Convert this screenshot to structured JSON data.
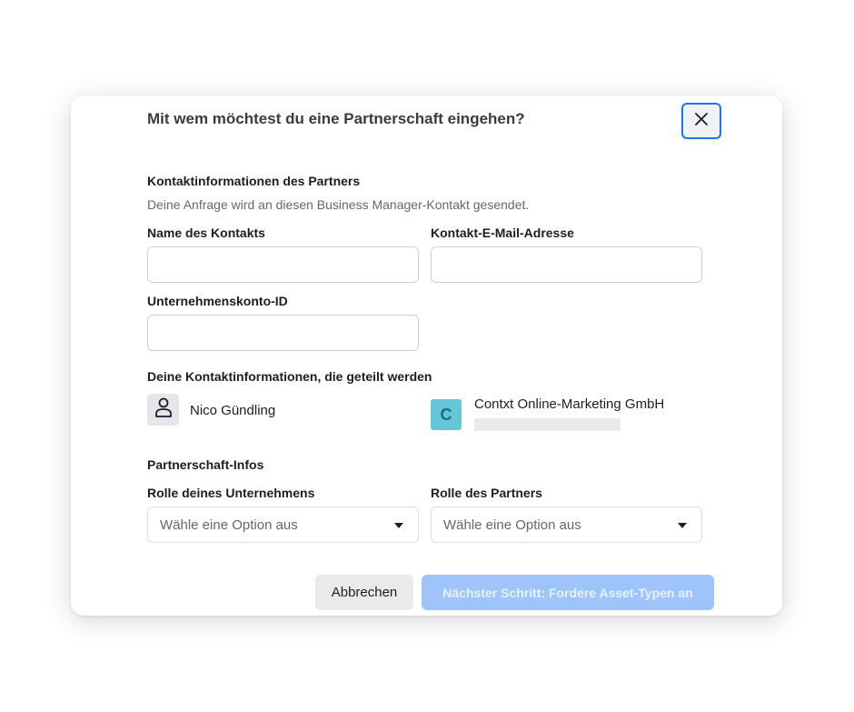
{
  "dialog": {
    "title": "Mit wem möchtest du eine Partnerschaft eingehen?",
    "close_icon": "close-icon"
  },
  "partner_contact": {
    "title": "Kontaktinformationen des Partners",
    "description": "Deine Anfrage wird an diesen Business Manager-Kontakt gesendet.",
    "name_label": "Name des Kontakts",
    "name_value": "",
    "email_label": "Kontakt-E-Mail-Adresse",
    "email_value": "",
    "account_id_label": "Unternehmenskonto-ID",
    "account_id_value": ""
  },
  "shared_info": {
    "title": "Deine Kontaktinformationen, die geteilt werden",
    "person_icon": "person-icon",
    "person_name": "Nico Gündling",
    "company_logo_letter": "C",
    "company_name": "Contxt Online-Marketing GmbH"
  },
  "partnership_info": {
    "title": "Partnerschaft-Infos",
    "own_role_label": "Rolle deines Unternehmens",
    "own_role_value": "Wähle eine Option aus",
    "partner_role_label": "Rolle des Partners",
    "partner_role_value": "Wähle eine Option aus"
  },
  "actions": {
    "cancel_label": "Abbrechen",
    "next_label": "Nächster Schritt: Fordere Asset-Typen an"
  },
  "colors": {
    "accent": "#1877f2",
    "primary_disabled": "#9fc4fb",
    "company_logo_bg": "#64c6d6"
  }
}
